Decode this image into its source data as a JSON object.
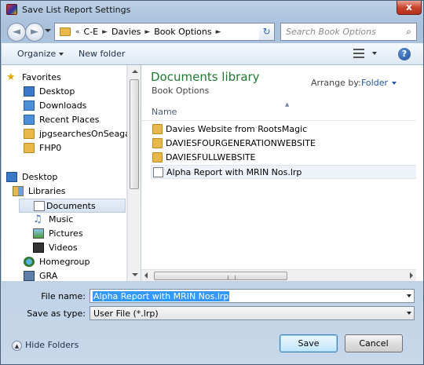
{
  "window": {
    "title": "Save List Report Settings",
    "close_label": "x"
  },
  "nav": {
    "back": "◄",
    "forward": "►",
    "breadcrumb_prefix": "«",
    "breadcrumb": [
      "C-E",
      "Davies",
      "Book Options"
    ],
    "search_placeholder": "Search Book Options"
  },
  "toolbar": {
    "organize": "Organize",
    "new_folder": "New folder",
    "help": "?"
  },
  "sidebar": {
    "items": [
      {
        "label": "Favorites",
        "icon": "star-icon"
      },
      {
        "label": "Desktop",
        "icon": "desktop-icon"
      },
      {
        "label": "Downloads",
        "icon": "downloads-icon"
      },
      {
        "label": "Recent Places",
        "icon": "recent-places-icon"
      },
      {
        "label": "jpgsearchesOnSeagate",
        "icon": "folder-icon"
      },
      {
        "label": "FHP0",
        "icon": "folder-icon"
      },
      {
        "label": "Desktop",
        "icon": "desktop-icon"
      },
      {
        "label": "Libraries",
        "icon": "libraries-icon"
      },
      {
        "label": "Documents",
        "icon": "documents-icon",
        "selected": true
      },
      {
        "label": "Music",
        "icon": "music-icon"
      },
      {
        "label": "Pictures",
        "icon": "pictures-icon"
      },
      {
        "label": "Videos",
        "icon": "videos-icon"
      },
      {
        "label": "Homegroup",
        "icon": "homegroup-icon"
      },
      {
        "label": "GRA",
        "icon": "computer-icon"
      }
    ]
  },
  "content": {
    "library_title": "Documents library",
    "library_subtitle": "Book Options",
    "arrange_by_label": "Arrange by:",
    "arrange_by_value": "Folder",
    "column_name": "Name",
    "files": [
      {
        "name": "Davies Website from RootsMagic",
        "type": "folder"
      },
      {
        "name": "DAVIESFOURGENERATIONWEBSITE",
        "type": "folder"
      },
      {
        "name": "DAVIESFULLWEBSITE",
        "type": "folder"
      },
      {
        "name": "Alpha Report with MRIN Nos.lrp",
        "type": "file"
      }
    ]
  },
  "form": {
    "file_name_label": "File name:",
    "file_name_value": "Alpha Report with MRIN Nos.lrp",
    "save_type_label": "Save as type:",
    "save_type_value": "User File (*.lrp)"
  },
  "footer": {
    "hide_folders": "Hide Folders",
    "save": "Save",
    "cancel": "Cancel"
  }
}
